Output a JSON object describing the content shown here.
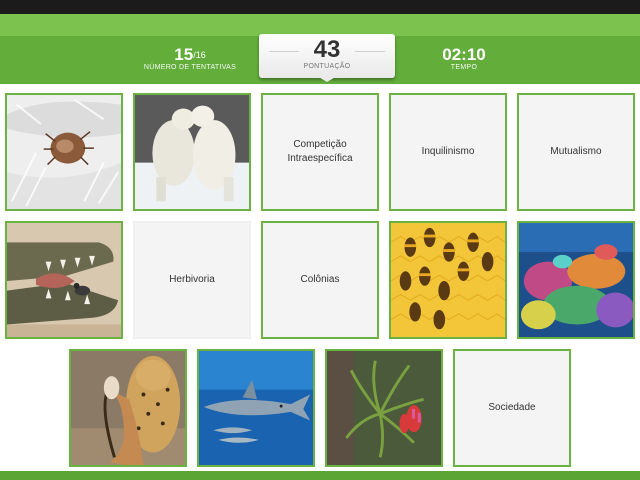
{
  "header": {
    "attempts_value": "15",
    "attempts_total": "/16",
    "attempts_label": "NÚMERO DE TENTATIVAS",
    "score_value": "43",
    "score_label": "PONTUAÇÃO",
    "time_value": "02:10",
    "time_label": "TEMPO"
  },
  "cards": {
    "competicao": "Competição Intraespecífica",
    "inquilinismo": "Inquilinismo",
    "mutualismo": "Mutualismo",
    "herbivoria": "Herbivoria",
    "colonias": "Colônias",
    "sociedade": "Sociedade"
  },
  "colors": {
    "header_light": "#7bc24f",
    "header_dark": "#63ad3b",
    "card_border": "#6ab343"
  }
}
